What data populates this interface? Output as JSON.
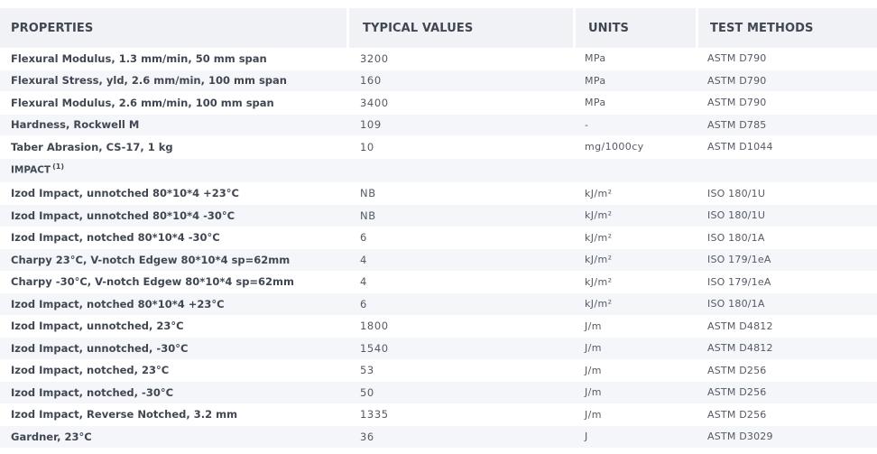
{
  "headers": {
    "properties": "PROPERTIES",
    "typical_values": "TYPICAL VALUES",
    "units": "UNITS",
    "test_methods": "TEST METHODS"
  },
  "rows_top": [
    {
      "property": "Flexural Modulus, 1.3 mm/min, 50 mm span",
      "value": "3200",
      "unit": "MPa",
      "method": "ASTM D790"
    },
    {
      "property": "Flexural Stress, yld, 2.6 mm/min, 100 mm span",
      "value": "160",
      "unit": "MPa",
      "method": "ASTM D790"
    },
    {
      "property": "Flexural Modulus, 2.6 mm/min, 100 mm span",
      "value": "3400",
      "unit": "MPa",
      "method": "ASTM D790"
    },
    {
      "property": "Hardness, Rockwell M",
      "value": "109",
      "unit": "-",
      "method": "ASTM D785"
    },
    {
      "property": "Taber Abrasion, CS-17, 1 kg",
      "value": "10",
      "unit": "mg/1000cy",
      "method": "ASTM D1044"
    }
  ],
  "section": {
    "label": "IMPACT",
    "footnote": "(1)"
  },
  "rows_impact": [
    {
      "property": "Izod Impact, unnotched 80*10*4 +23°C",
      "value": "NB",
      "unit": "kJ/m²",
      "method": "ISO 180/1U"
    },
    {
      "property": "Izod Impact, unnotched 80*10*4 -30°C",
      "value": "NB",
      "unit": "kJ/m²",
      "method": "ISO 180/1U"
    },
    {
      "property": "Izod Impact, notched 80*10*4 -30°C",
      "value": "6",
      "unit": "kJ/m²",
      "method": "ISO 180/1A"
    },
    {
      "property": "Charpy 23°C, V-notch Edgew 80*10*4 sp=62mm",
      "value": "4",
      "unit": "kJ/m²",
      "method": "ISO 179/1eA"
    },
    {
      "property": "Charpy -30°C, V-notch Edgew 80*10*4 sp=62mm",
      "value": "4",
      "unit": "kJ/m²",
      "method": "ISO 179/1eA"
    },
    {
      "property": "Izod Impact, notched 80*10*4 +23°C",
      "value": "6",
      "unit": "kJ/m²",
      "method": "ISO 180/1A"
    },
    {
      "property": "Izod Impact, unnotched, 23°C",
      "value": "1800",
      "unit": "J/m",
      "method": "ASTM D4812"
    },
    {
      "property": "Izod Impact, unnotched, -30°C",
      "value": "1540",
      "unit": "J/m",
      "method": "ASTM D4812"
    },
    {
      "property": "Izod Impact, notched, 23°C",
      "value": "53",
      "unit": "J/m",
      "method": "ASTM D256"
    },
    {
      "property": "Izod Impact, notched, -30°C",
      "value": "50",
      "unit": "J/m",
      "method": "ASTM D256"
    },
    {
      "property": "Izod Impact, Reverse Notched, 3.2 mm",
      "value": "1335",
      "unit": "J/m",
      "method": "ASTM D256"
    },
    {
      "property": "Gardner, 23°C",
      "value": "36",
      "unit": "J",
      "method": "ASTM D3029"
    }
  ]
}
